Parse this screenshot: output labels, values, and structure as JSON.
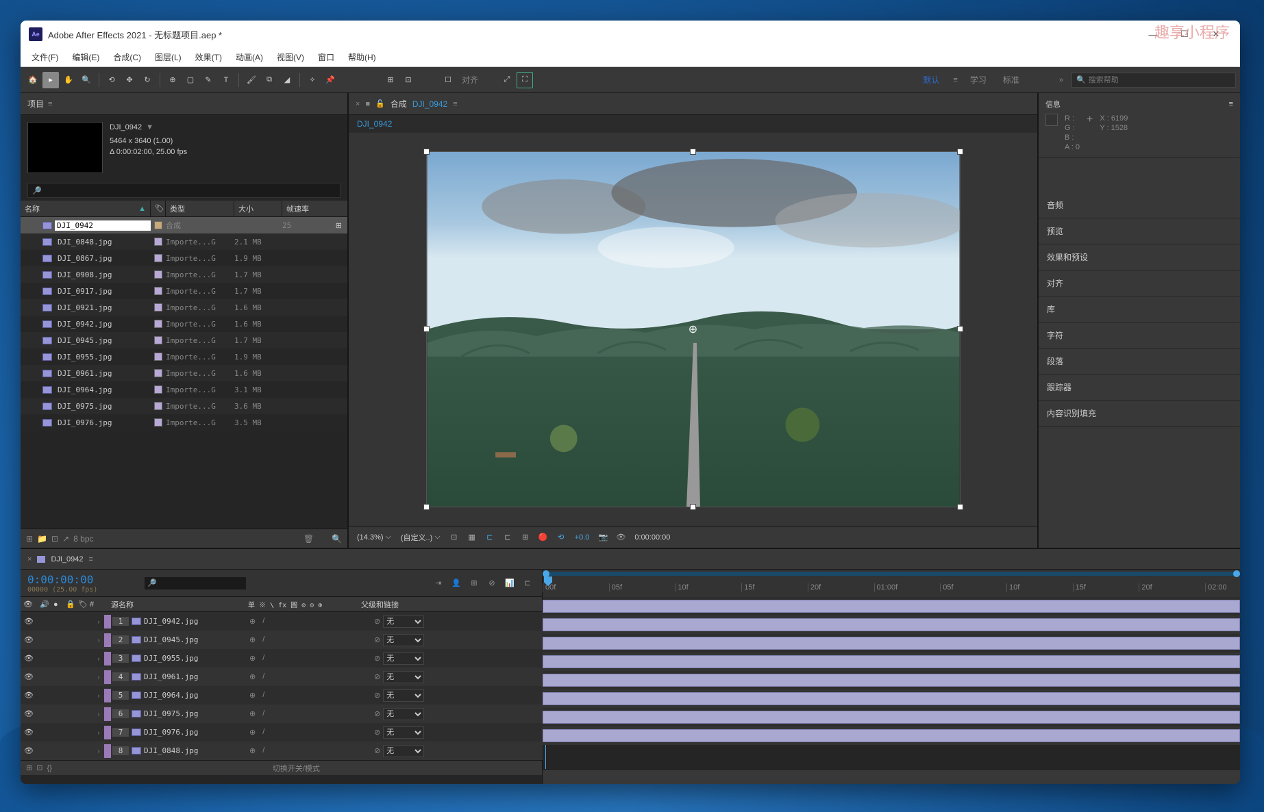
{
  "watermark": "趣享小程序",
  "titlebar": {
    "app_abbr": "Ae",
    "title": "Adobe After Effects 2021 - 无标题项目.aep *"
  },
  "menubar": [
    "文件(F)",
    "编辑(E)",
    "合成(C)",
    "图层(L)",
    "效果(T)",
    "动画(A)",
    "视图(V)",
    "窗口",
    "帮助(H)"
  ],
  "toolbar": {
    "align": "对齐",
    "default": "默认",
    "learn": "学习",
    "standard": "标准",
    "search_placeholder": "搜索帮助"
  },
  "project": {
    "panel_title": "项目",
    "selected_name": "DJI_0942",
    "dimensions": "5464 x 3640 (1.00)",
    "duration": "Δ 0:00:02:00, 25.00 fps",
    "cols": {
      "name": "名称",
      "tag": "",
      "type": "类型",
      "size": "大小",
      "fps": "帧速率"
    },
    "items": [
      {
        "name": "DJI_0942",
        "type": "合成",
        "size": "",
        "fps": "25",
        "comp": true,
        "selected": true
      },
      {
        "name": "DJI_0848.jpg",
        "type": "Importe...G",
        "size": "2.1 MB"
      },
      {
        "name": "DJI_0867.jpg",
        "type": "Importe...G",
        "size": "1.9 MB"
      },
      {
        "name": "DJI_0908.jpg",
        "type": "Importe...G",
        "size": "1.7 MB"
      },
      {
        "name": "DJI_0917.jpg",
        "type": "Importe...G",
        "size": "1.7 MB"
      },
      {
        "name": "DJI_0921.jpg",
        "type": "Importe...G",
        "size": "1.6 MB"
      },
      {
        "name": "DJI_0942.jpg",
        "type": "Importe...G",
        "size": "1.6 MB"
      },
      {
        "name": "DJI_0945.jpg",
        "type": "Importe...G",
        "size": "1.7 MB"
      },
      {
        "name": "DJI_0955.jpg",
        "type": "Importe...G",
        "size": "1.9 MB"
      },
      {
        "name": "DJI_0961.jpg",
        "type": "Importe...G",
        "size": "1.6 MB"
      },
      {
        "name": "DJI_0964.jpg",
        "type": "Importe...G",
        "size": "3.1 MB"
      },
      {
        "name": "DJI_0975.jpg",
        "type": "Importe...G",
        "size": "3.6 MB"
      },
      {
        "name": "DJI_0976.jpg",
        "type": "Importe...G",
        "size": "3.5 MB"
      }
    ],
    "bpc": "8 bpc"
  },
  "composition": {
    "lock": "🔓",
    "prefix": "合成",
    "name": "DJI_0942",
    "flow": "DJI_0942",
    "zoom": "(14.3%)",
    "custom": "(自定义..)",
    "exposure": "+0.0",
    "time": "0:00:00:00"
  },
  "info": {
    "title": "信息",
    "r": "R :",
    "g": "G :",
    "b": "B :",
    "a": "A : 0",
    "x": "X : 6199",
    "y": "Y : 1528"
  },
  "side_panels": [
    "音频",
    "预览",
    "效果和预设",
    "对齐",
    "库",
    "字符",
    "段落",
    "跟踪器",
    "内容识别填充"
  ],
  "timeline": {
    "comp": "DJI_0942",
    "time": "0:00:00:00",
    "sub": "00000 (25.00 fps)",
    "ticks": [
      "00f",
      "05f",
      "10f",
      "15f",
      "20f",
      "01:00f",
      "05f",
      "10f",
      "15f",
      "20f",
      "02:00"
    ],
    "col_source": "源名称",
    "switches": "单 ※ \\ fx 圓 ⊘ ⊙ ⊕",
    "col_parent": "父级和链接",
    "parent_none": "无",
    "layers": [
      {
        "num": "1",
        "name": "DJI_0942.jpg"
      },
      {
        "num": "2",
        "name": "DJI_0945.jpg"
      },
      {
        "num": "3",
        "name": "DJI_0955.jpg"
      },
      {
        "num": "4",
        "name": "DJI_0961.jpg"
      },
      {
        "num": "5",
        "name": "DJI_0964.jpg"
      },
      {
        "num": "6",
        "name": "DJI_0975.jpg"
      },
      {
        "num": "7",
        "name": "DJI_0976.jpg"
      },
      {
        "num": "8",
        "name": "DJI_0848.jpg"
      }
    ],
    "footer_text": "切换开关/模式"
  }
}
